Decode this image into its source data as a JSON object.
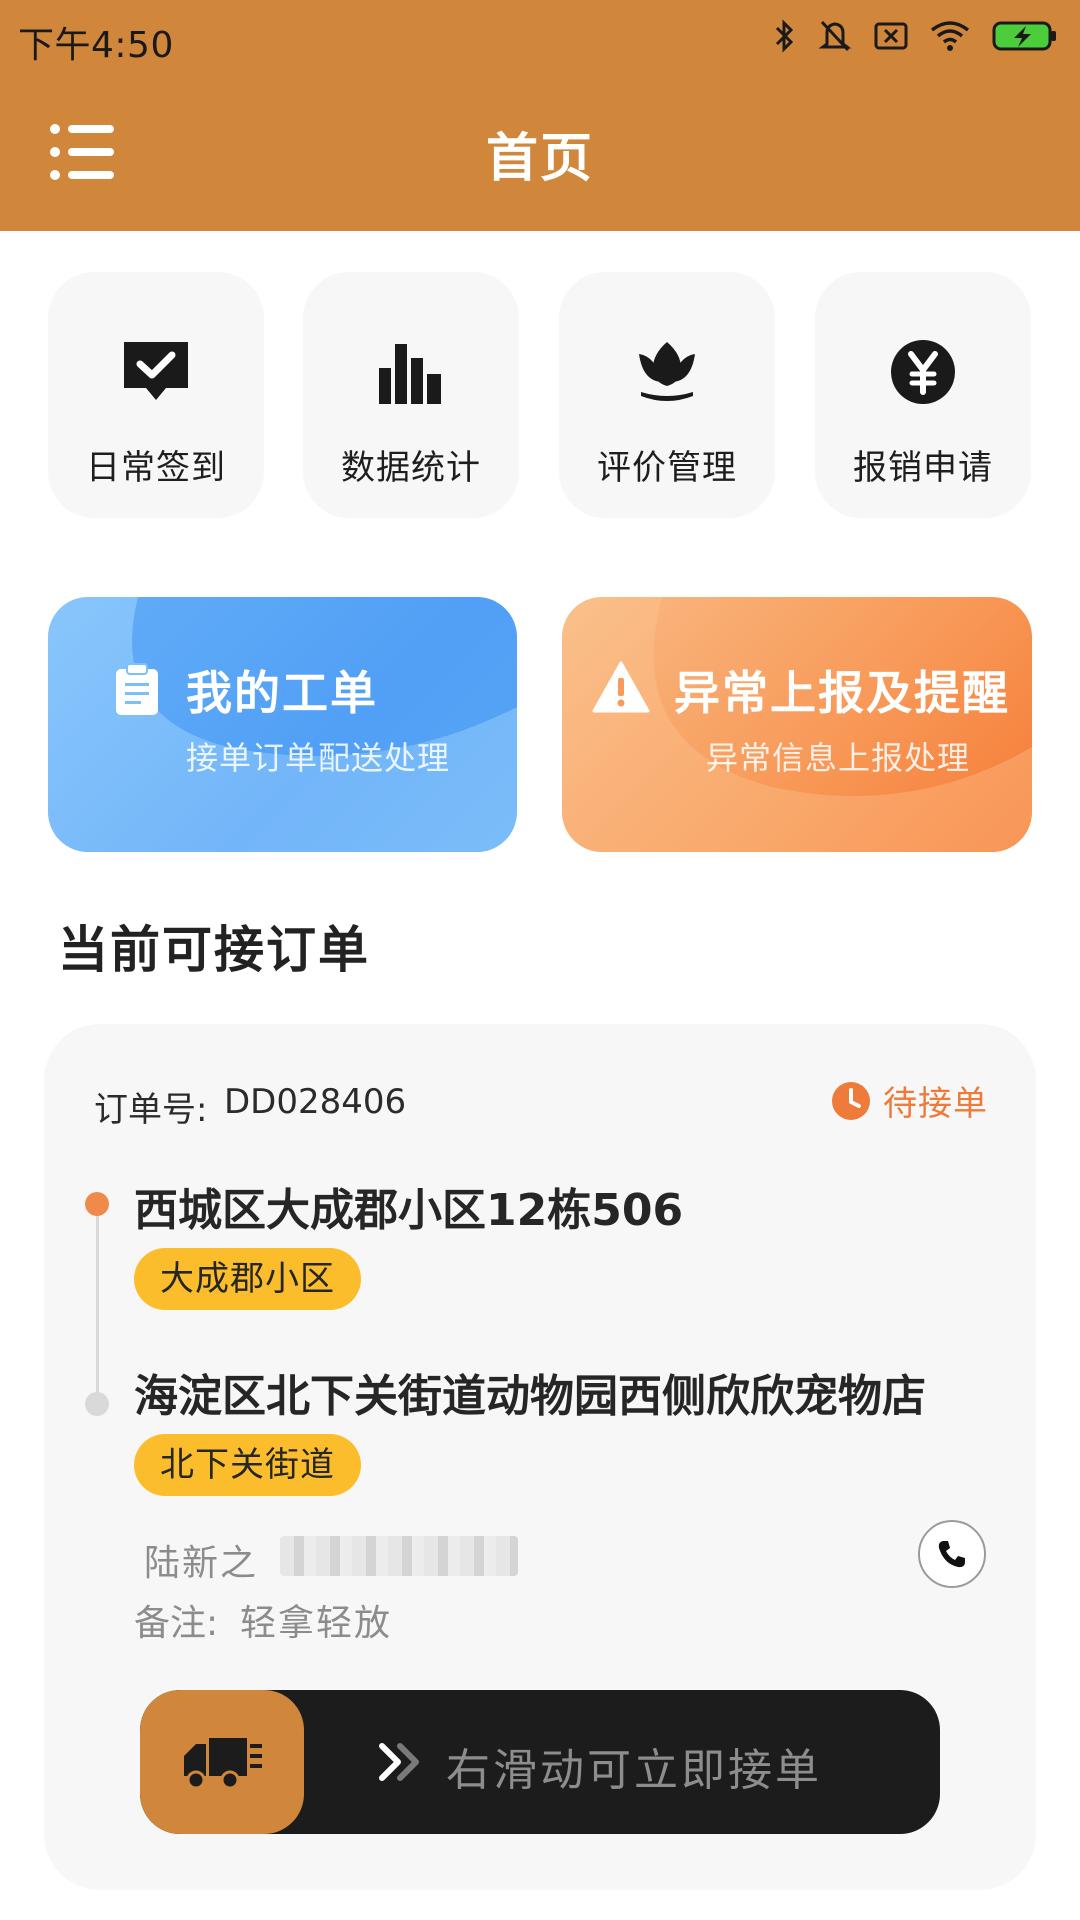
{
  "status_bar": {
    "time": "下午4:50",
    "icons": [
      "bluetooth-icon",
      "mute-icon",
      "sim-icon",
      "wifi-icon",
      "battery-charging-icon"
    ],
    "battery_color": "#4ccd3b"
  },
  "app_bar": {
    "title": "首页",
    "menu_icon": "menu-icon",
    "background": "#D0863B"
  },
  "quick_actions": [
    {
      "label": "日常签到",
      "icon": "checkin-heart-icon"
    },
    {
      "label": "数据统计",
      "icon": "bar-chart-icon"
    },
    {
      "label": "评价管理",
      "icon": "lotus-icon"
    },
    {
      "label": "报销申请",
      "icon": "yen-coin-icon"
    }
  ],
  "features": {
    "my_orders": {
      "title": "我的工单",
      "subtitle": "接单订单配送处理",
      "icon": "clipboard-icon",
      "color": "#5aa7f7"
    },
    "exception": {
      "title": "异常上报及提醒",
      "subtitle": "异常信息上报处理",
      "icon": "warning-icon",
      "color": "#f89a59"
    }
  },
  "section": {
    "title": "当前可接订单"
  },
  "order": {
    "number_label": "订单号:",
    "number": "DD028406",
    "status": "待接单",
    "status_icon": "clock-icon",
    "status_color": "#ee7b39",
    "from_address": "西城区大成郡小区12栋506",
    "from_tag": "大成郡小区",
    "to_address": "海淀区北下关街道动物园西侧欣欣宠物店",
    "to_tag": "北下关街道",
    "contact_name": "陆新之",
    "contact_phone": "",
    "call_icon": "phone-icon",
    "remark_label": "备注:",
    "remark": "轻拿轻放",
    "tag_color": "#fbbd2c"
  },
  "slider": {
    "hint": "右滑动可立即接单",
    "handle_icon": "truck-icon",
    "arrow_icon": "double-chevron-right-icon",
    "progress": 0
  }
}
